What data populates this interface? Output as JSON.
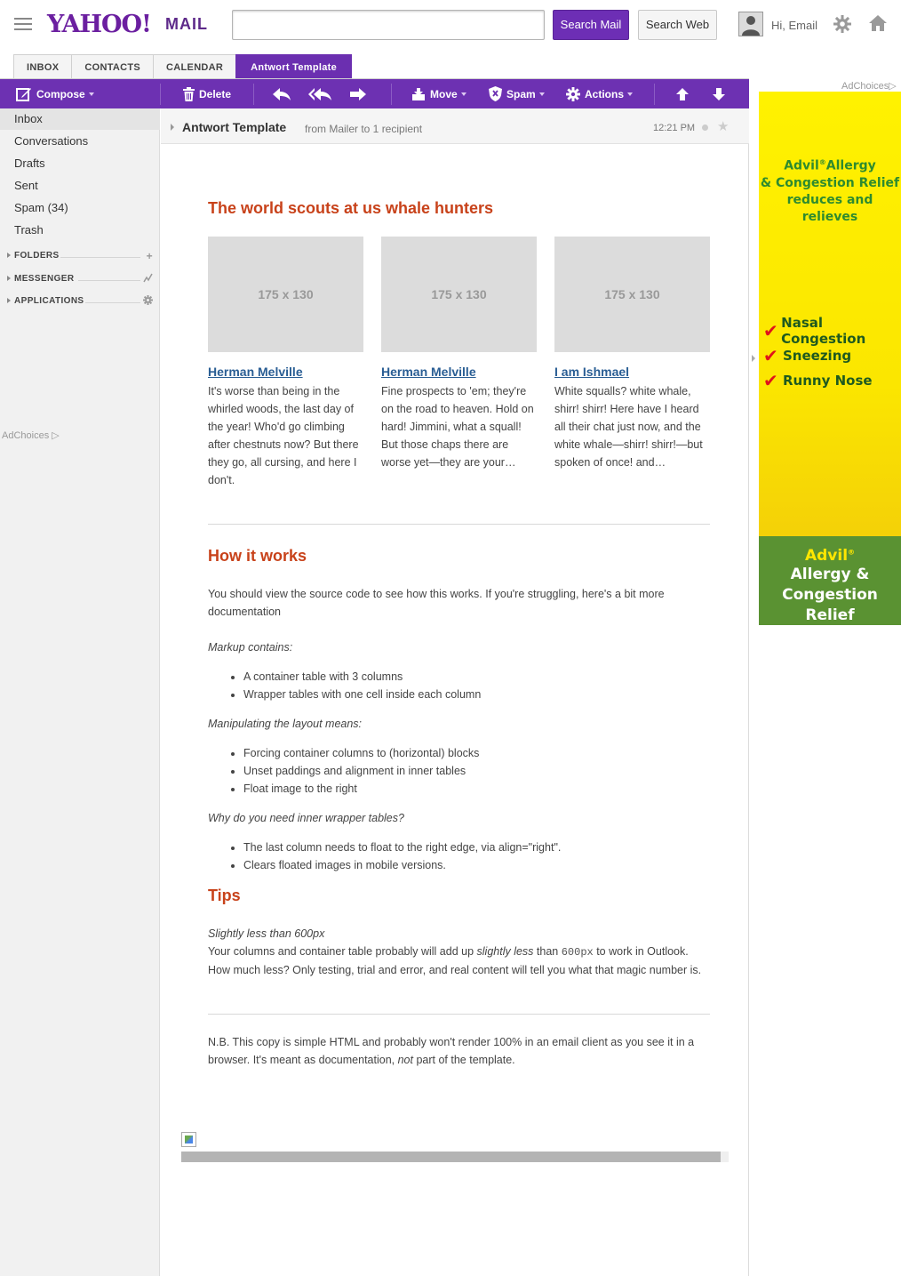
{
  "header": {
    "logo": "YAHOO!",
    "logo_suffix": "MAIL",
    "search_placeholder": "",
    "search_mail": "Search Mail",
    "search_web": "Search Web",
    "greeting": "Hi, Email"
  },
  "tabs": [
    {
      "label": "INBOX"
    },
    {
      "label": "CONTACTS"
    },
    {
      "label": "CALENDAR"
    },
    {
      "label": "Antwort Template"
    }
  ],
  "toolbar": {
    "compose": "Compose",
    "delete": "Delete",
    "move": "Move",
    "spam": "Spam",
    "actions": "Actions"
  },
  "sidebar": {
    "items": [
      {
        "label": "Inbox"
      },
      {
        "label": "Conversations"
      },
      {
        "label": "Drafts"
      },
      {
        "label": "Sent"
      },
      {
        "label": "Spam (34)"
      },
      {
        "label": "Trash"
      }
    ],
    "sections": [
      {
        "label": "FOLDERS"
      },
      {
        "label": "MESSENGER"
      },
      {
        "label": "APPLICATIONS"
      }
    ],
    "adchoices": "AdChoices"
  },
  "message": {
    "subject": "Antwort Template",
    "from": "from Mailer to 1 recipient",
    "time": "12:21 PM",
    "heading1": "The world scouts at us whale hunters",
    "columns": [
      {
        "image": "175 x 130",
        "link": "Herman Melville",
        "text": "It's worse than being in the whirled woods, the last day of the year! Who'd go climbing after chestnuts now? But there they go, all cursing, and here I don't."
      },
      {
        "image": "175 x 130",
        "link": "Herman Melville",
        "text": "Fine prospects to 'em; they're on the road to heaven. Hold on hard! Jimmini, what a squall! But those chaps there are worse yet—they are your…"
      },
      {
        "image": "175 x 130",
        "link": "I am Ishmael",
        "text": "White squalls? white whale, shirr! shirr! Here have I heard all their chat just now, and the white whale—shirr! shirr!—but spoken of once! and…"
      }
    ],
    "heading2": "How it works",
    "intro": "You should view the source code to see how this works. If you're struggling, here's a bit more documentation",
    "markup_label": "Markup contains:",
    "markup_items": [
      "A container table with 3 columns",
      "Wrapper tables with one cell inside each column"
    ],
    "manip_label": "Manipulating the layout means:",
    "manip_items": [
      "Forcing container columns to (horizontal) blocks",
      "Unset paddings and alignment in inner tables",
      "Float image to the right"
    ],
    "why_label": "Why do you need inner wrapper tables?",
    "why_items": [
      "The last column needs to float to the right edge, via align=\"right\".",
      "Clears floated images in mobile versions."
    ],
    "heading3": "Tips",
    "tip_label": "Slightly less than 600px",
    "tip_text_1": "Your columns and container table probably will add up ",
    "tip_text_em": "slightly less",
    "tip_text_2": " than ",
    "tip_code": "600px",
    "tip_text_3": " to work in Outlook. How much less? Only testing, trial and error, and real content will tell you what that magic number is.",
    "nb_1": "N.B. This copy is simple HTML and probably won't render 100% in an email client as you see it in a browser. It's meant as documentation, ",
    "nb_em": "not",
    "nb_2": " part of the template.",
    "progress_fraction": 0.985
  },
  "ad": {
    "adchoices": "AdChoices",
    "headline_brand": "Advil",
    "headline_reg": "®",
    "headline_rest": "Allergy",
    "headline_line2": "& Congestion Relief",
    "headline_line3": "reduces and relieves",
    "symptoms": [
      "Nasal Congestion",
      "Sneezing",
      "Runny Nose"
    ],
    "footer_brand": "Advil",
    "footer_reg": "®",
    "footer_line1": "Allergy &",
    "footer_line2": "Congestion",
    "footer_line3": "Relief"
  },
  "colors": {
    "brand_purple": "#6d31b2",
    "heading_orange": "#c8421a",
    "link_blue": "#2a5e94",
    "ad_yellow": "#fff200",
    "ad_green": "#5a9232"
  }
}
